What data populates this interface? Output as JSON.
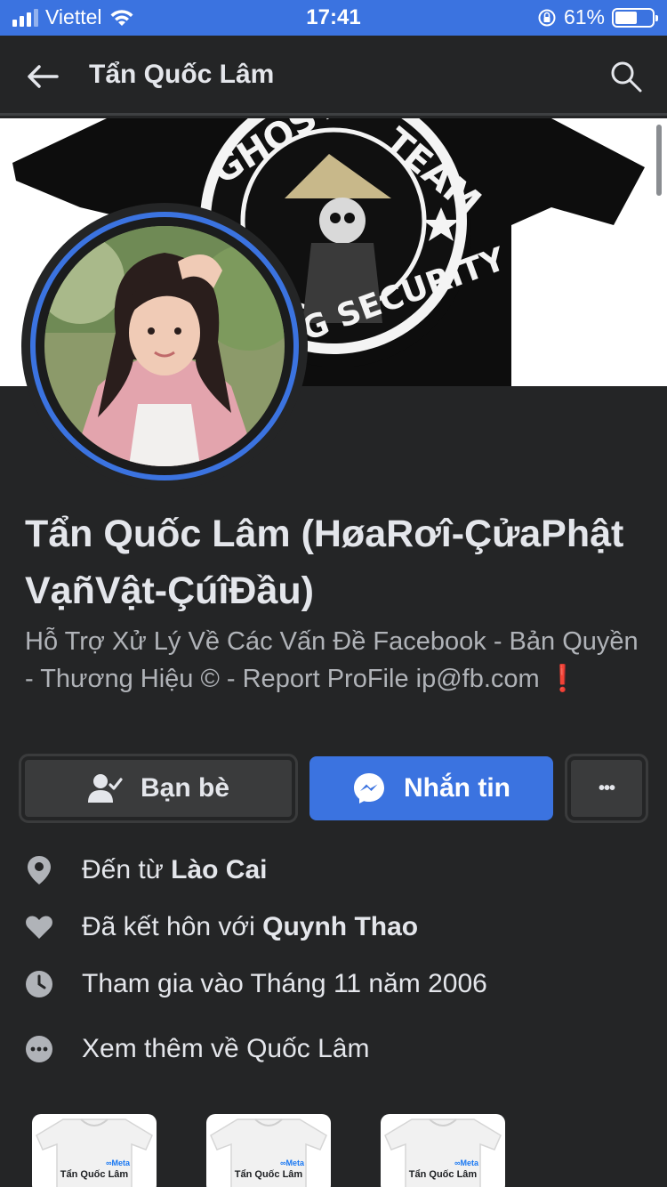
{
  "status_bar": {
    "carrier": "Viettel",
    "time": "17:41",
    "battery_percent": "61%",
    "battery_level": 0.61
  },
  "nav": {
    "title": "Tẩn Quốc Lâm"
  },
  "profile": {
    "name": "Tẩn Quốc Lâm (HøaRơî-ÇửaPhật VạñVật-ÇúîĐầu)",
    "bio_line": "Hỗ Trợ Xử Lý Về Các Vấn Đề Facebook - Bản Quyền - Thương Hiệu © - Report ProFile ip@fb.com",
    "bio_emoji": "❗"
  },
  "actions": {
    "friends_label": "Bạn bè",
    "message_label": "Nhắn tin",
    "more_label": "•••"
  },
  "details": {
    "from_prefix": "Đến từ ",
    "from_place": "Lào Cai",
    "married_prefix": "Đã kết hôn với ",
    "married_name": "Quynh Thao",
    "joined": "Tham gia vào Tháng 11 năm 2006",
    "see_more": "Xem thêm về Quốc Lâm"
  },
  "cards": [
    {
      "label": "Tẩn Quốc Lâm",
      "meta": "∞Meta"
    },
    {
      "label": "Tẩn Quốc Lâm",
      "meta": "∞Meta"
    },
    {
      "label": "Tẩn Quốc Lâm",
      "meta": "∞Meta"
    }
  ],
  "colors": {
    "accent": "#3b73e0",
    "background": "#242526",
    "button_gray": "#3a3b3c"
  }
}
